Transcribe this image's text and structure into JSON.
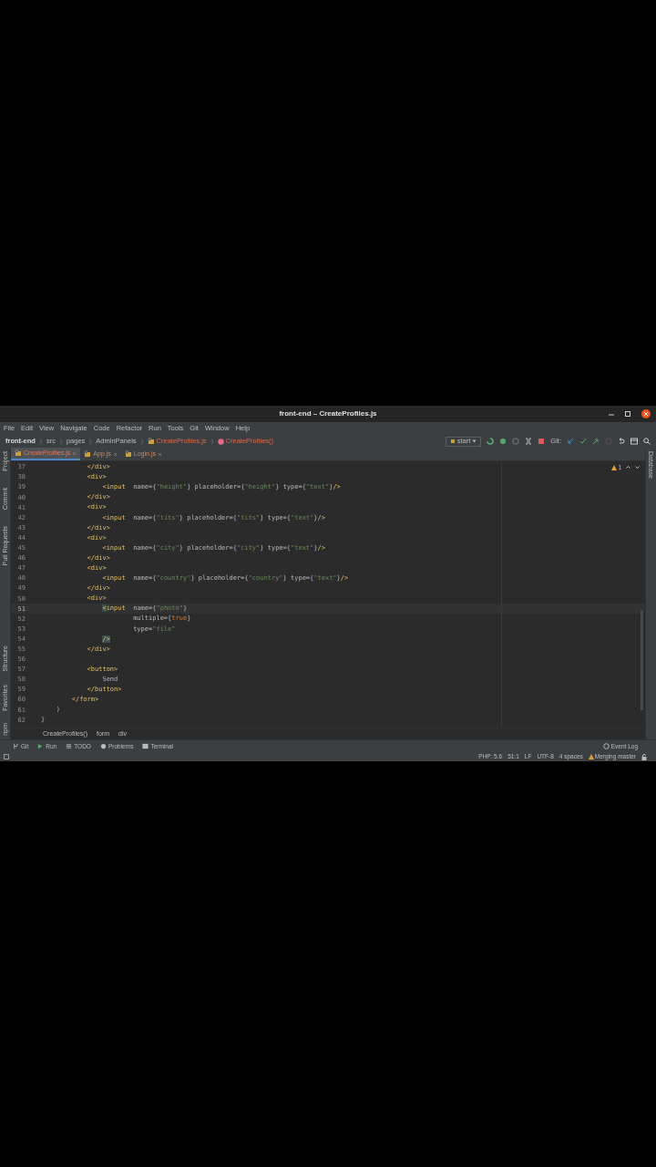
{
  "window": {
    "title": "front-end – CreateProfiles.js"
  },
  "menu": [
    "File",
    "Edit",
    "View",
    "Navigate",
    "Code",
    "Refactor",
    "Run",
    "Tools",
    "Git",
    "Window",
    "Help"
  ],
  "navigation_bar": {
    "path": [
      {
        "label": "front-end",
        "kind": "project"
      },
      {
        "label": "src",
        "kind": "folder"
      },
      {
        "label": "pages",
        "kind": "folder"
      },
      {
        "label": "AdminPanels",
        "kind": "folder"
      },
      {
        "label": "CreateProfiles.js",
        "kind": "file"
      },
      {
        "label": "CreateProfiles()",
        "kind": "function"
      }
    ],
    "run_config": "start",
    "git_label": "Git:"
  },
  "tabs": [
    {
      "label": "CreateProfiles.js",
      "selected": true
    },
    {
      "label": "App.js",
      "selected": false
    },
    {
      "label": "Login.js",
      "selected": false
    }
  ],
  "left_tool_strip": {
    "top": [
      "Project",
      "Commit",
      "Pull Requests"
    ],
    "bottom": [
      "Structure",
      "Favorites",
      "npm"
    ]
  },
  "right_tool_strip": [
    "Database"
  ],
  "editor": {
    "warning_count": "1",
    "lines": [
      {
        "number": "37",
        "current": false,
        "tokens": [
          {
            "kind": "tag",
            "text": "            </div>"
          }
        ]
      },
      {
        "number": "38",
        "current": false,
        "tokens": [
          {
            "kind": "tag",
            "text": "            <div>"
          }
        ]
      },
      {
        "number": "39",
        "current": false,
        "tokens": [
          {
            "kind": "tag",
            "text": "                <input"
          },
          {
            "kind": "attr",
            "text": "  name="
          },
          {
            "kind": "plain",
            "text": "{"
          },
          {
            "kind": "string",
            "text": "\"height\""
          },
          {
            "kind": "plain",
            "text": "}"
          },
          {
            "kind": "attr",
            "text": " placeholder="
          },
          {
            "kind": "plain",
            "text": "{"
          },
          {
            "kind": "string",
            "text": "\"height\""
          },
          {
            "kind": "plain",
            "text": "}"
          },
          {
            "kind": "attr",
            "text": " type="
          },
          {
            "kind": "plain",
            "text": "{"
          },
          {
            "kind": "string",
            "text": "\"text\""
          },
          {
            "kind": "plain",
            "text": "}"
          },
          {
            "kind": "tag",
            "text": "/>"
          }
        ]
      },
      {
        "number": "40",
        "current": false,
        "tokens": [
          {
            "kind": "tag",
            "text": "            </div>"
          }
        ]
      },
      {
        "number": "41",
        "current": false,
        "tokens": [
          {
            "kind": "tag",
            "text": "            <div>"
          }
        ]
      },
      {
        "number": "42",
        "current": false,
        "tokens": [
          {
            "kind": "tag",
            "text": "                <input"
          },
          {
            "kind": "attr",
            "text": "  name="
          },
          {
            "kind": "plain",
            "text": "{"
          },
          {
            "kind": "string",
            "text": "\"tits\""
          },
          {
            "kind": "plain",
            "text": "}"
          },
          {
            "kind": "attr",
            "text": " placeholder="
          },
          {
            "kind": "plain",
            "text": "{"
          },
          {
            "kind": "string",
            "text": "\"tits\""
          },
          {
            "kind": "plain",
            "text": "}"
          },
          {
            "kind": "attr",
            "text": " type="
          },
          {
            "kind": "plain",
            "text": "{"
          },
          {
            "kind": "string",
            "text": "\"text\""
          },
          {
            "kind": "plain",
            "text": "}"
          },
          {
            "kind": "tag",
            "text": "/>"
          }
        ]
      },
      {
        "number": "43",
        "current": false,
        "tokens": [
          {
            "kind": "tag",
            "text": "            </div>"
          }
        ]
      },
      {
        "number": "44",
        "current": false,
        "tokens": [
          {
            "kind": "tag",
            "text": "            <div>"
          }
        ]
      },
      {
        "number": "45",
        "current": false,
        "tokens": [
          {
            "kind": "tag",
            "text": "                <input"
          },
          {
            "kind": "attr",
            "text": "  name="
          },
          {
            "kind": "plain",
            "text": "{"
          },
          {
            "kind": "string",
            "text": "\"city\""
          },
          {
            "kind": "plain",
            "text": "}"
          },
          {
            "kind": "attr",
            "text": " placeholder="
          },
          {
            "kind": "plain",
            "text": "{"
          },
          {
            "kind": "string",
            "text": "\"city\""
          },
          {
            "kind": "plain",
            "text": "}"
          },
          {
            "kind": "attr",
            "text": " type="
          },
          {
            "kind": "plain",
            "text": "{"
          },
          {
            "kind": "string",
            "text": "\"text\""
          },
          {
            "kind": "plain",
            "text": "}"
          },
          {
            "kind": "tag",
            "text": "/>"
          }
        ]
      },
      {
        "number": "46",
        "current": false,
        "tokens": [
          {
            "kind": "tag",
            "text": "            </div>"
          }
        ]
      },
      {
        "number": "47",
        "current": false,
        "tokens": [
          {
            "kind": "tag",
            "text": "            <div>"
          }
        ]
      },
      {
        "number": "48",
        "current": false,
        "tokens": [
          {
            "kind": "tag",
            "text": "                <input"
          },
          {
            "kind": "attr",
            "text": "  name="
          },
          {
            "kind": "plain",
            "text": "{"
          },
          {
            "kind": "string",
            "text": "\"country\""
          },
          {
            "kind": "plain",
            "text": "}"
          },
          {
            "kind": "attr",
            "text": " placeholder="
          },
          {
            "kind": "plain",
            "text": "{"
          },
          {
            "kind": "string",
            "text": "\"country\""
          },
          {
            "kind": "plain",
            "text": "}"
          },
          {
            "kind": "attr",
            "text": " type="
          },
          {
            "kind": "plain",
            "text": "{"
          },
          {
            "kind": "string",
            "text": "\"text\""
          },
          {
            "kind": "plain",
            "text": "}"
          },
          {
            "kind": "tag",
            "text": "/>"
          }
        ]
      },
      {
        "number": "49",
        "current": false,
        "tokens": [
          {
            "kind": "tag",
            "text": "            </div>"
          }
        ]
      },
      {
        "number": "50",
        "current": false,
        "tokens": [
          {
            "kind": "tag",
            "text": "            <div>"
          }
        ]
      },
      {
        "number": "51",
        "current": true,
        "tokens": [
          {
            "kind": "matched",
            "text": "                <"
          },
          {
            "kind": "tag",
            "text": "input"
          },
          {
            "kind": "attr",
            "text": "  name="
          },
          {
            "kind": "plain",
            "text": "{"
          },
          {
            "kind": "string",
            "text": "\"photo\""
          },
          {
            "kind": "plain",
            "text": "}"
          }
        ]
      },
      {
        "number": "52",
        "current": false,
        "tokens": [
          {
            "kind": "attr",
            "text": "                        multiple="
          },
          {
            "kind": "plain",
            "text": "{"
          },
          {
            "kind": "keyword",
            "text": "true"
          },
          {
            "kind": "plain",
            "text": "}"
          }
        ]
      },
      {
        "number": "53",
        "current": false,
        "tokens": [
          {
            "kind": "attr",
            "text": "                        type="
          },
          {
            "kind": "string",
            "text": "\"file\""
          }
        ]
      },
      {
        "number": "54",
        "current": false,
        "tokens": [
          {
            "kind": "matched",
            "text": "                />"
          }
        ]
      },
      {
        "number": "55",
        "current": false,
        "tokens": [
          {
            "kind": "tag",
            "text": "            </div>"
          }
        ]
      },
      {
        "number": "56",
        "current": false
      },
      {
        "number": "57",
        "current": false,
        "tokens": [
          {
            "kind": "tag",
            "text": "            <button>"
          }
        ]
      },
      {
        "number": "58",
        "current": false,
        "tokens": [
          {
            "kind": "text",
            "text": "                Send"
          }
        ]
      },
      {
        "number": "59",
        "current": false,
        "tokens": [
          {
            "kind": "tag",
            "text": "            </button>"
          }
        ]
      },
      {
        "number": "60",
        "current": false,
        "tokens": [
          {
            "kind": "tag",
            "text": "        </form>"
          }
        ]
      },
      {
        "number": "61",
        "current": false,
        "tokens": [
          {
            "kind": "plain",
            "text": "    )"
          }
        ]
      },
      {
        "number": "62",
        "current": false,
        "tokens": [
          {
            "kind": "plain",
            "text": "}"
          }
        ]
      }
    ]
  },
  "breadcrumbs": [
    "CreateProfiles()",
    "form",
    "div"
  ],
  "tool_windows": [
    {
      "label": "Git",
      "kind": "git"
    },
    {
      "label": "Run",
      "kind": "run"
    },
    {
      "label": "TODO",
      "kind": "todo"
    },
    {
      "label": "Problems",
      "kind": "problems"
    },
    {
      "label": "Terminal",
      "kind": "terminal"
    }
  ],
  "event_log": "Event Log",
  "status_bar": [
    {
      "text": "PHP: 5.6",
      "kind": "plain"
    },
    {
      "text": "51:1",
      "kind": "plain"
    },
    {
      "text": "LF",
      "kind": "plain"
    },
    {
      "text": "UTF-8",
      "kind": "plain"
    },
    {
      "text": "4 spaces",
      "kind": "plain"
    },
    {
      "text": "Merging master",
      "kind": "warning"
    }
  ]
}
